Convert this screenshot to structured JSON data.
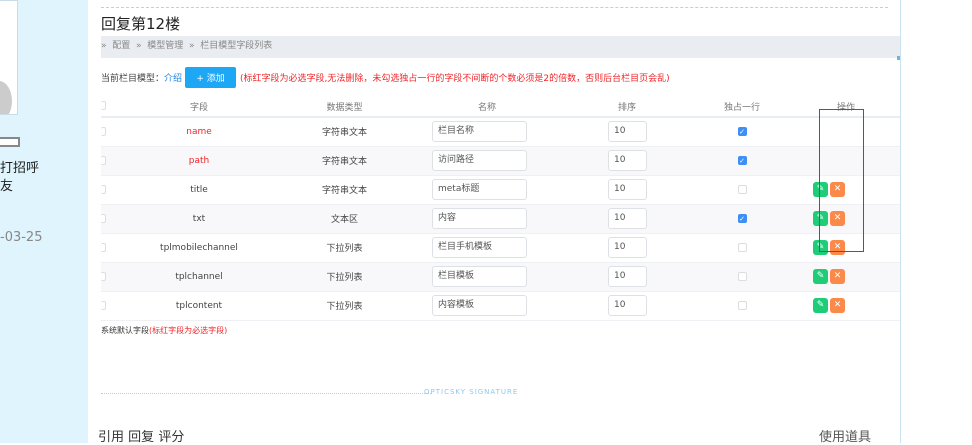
{
  "sidebar": {
    "greet": "打招呼",
    "friend": "友",
    "date": "-03-25"
  },
  "post": {
    "title": "回复第12楼",
    "breadcrumb": [
      "配置",
      "模型管理",
      "栏目模型字段列表"
    ],
    "breadcrumb_sep": "»",
    "toolbar": {
      "label": "当前栏目模型：",
      "model_link": "介绍",
      "add_label": "+ 添加",
      "warning": "(标红字段为必选字段,无法删除，未勾选独占一行的字段不间断的个数必须是2的倍数，否则后台栏目页会乱)"
    },
    "table": {
      "headers": [
        "字段",
        "数据类型",
        "名称",
        "排序",
        "独占一行",
        "操作"
      ],
      "rows": [
        {
          "field": "name",
          "type": "字符串文本",
          "name": "栏目名称",
          "sort": "10",
          "exclusive": true,
          "required": true
        },
        {
          "field": "path",
          "type": "字符串文本",
          "name": "访问路径",
          "sort": "10",
          "exclusive": true,
          "required": true
        },
        {
          "field": "title",
          "type": "字符串文本",
          "name": "meta标题",
          "sort": "10",
          "exclusive": false,
          "required": false
        },
        {
          "field": "txt",
          "type": "文本区",
          "name": "内容",
          "sort": "10",
          "exclusive": true,
          "required": false
        },
        {
          "field": "tplmobilechannel",
          "type": "下拉列表",
          "name": "栏目手机模板",
          "sort": "10",
          "exclusive": false,
          "required": false
        },
        {
          "field": "tplchannel",
          "type": "下拉列表",
          "name": "栏目模板",
          "sort": "10",
          "exclusive": false,
          "required": false
        },
        {
          "field": "tplcontent",
          "type": "下拉列表",
          "name": "内容模板",
          "sort": "10",
          "exclusive": false,
          "required": false
        }
      ]
    },
    "note": {
      "text": "系统默认字段",
      "red": "(标红字段为必选字段)"
    },
    "signature": "OPTICSKY SIGNATURE",
    "actions": {
      "quote": "引用",
      "reply": "回复",
      "rate": "评分",
      "tools": "使用道具"
    }
  },
  "icons": {
    "edit": "✎",
    "delete": "✕",
    "check": "✓"
  }
}
